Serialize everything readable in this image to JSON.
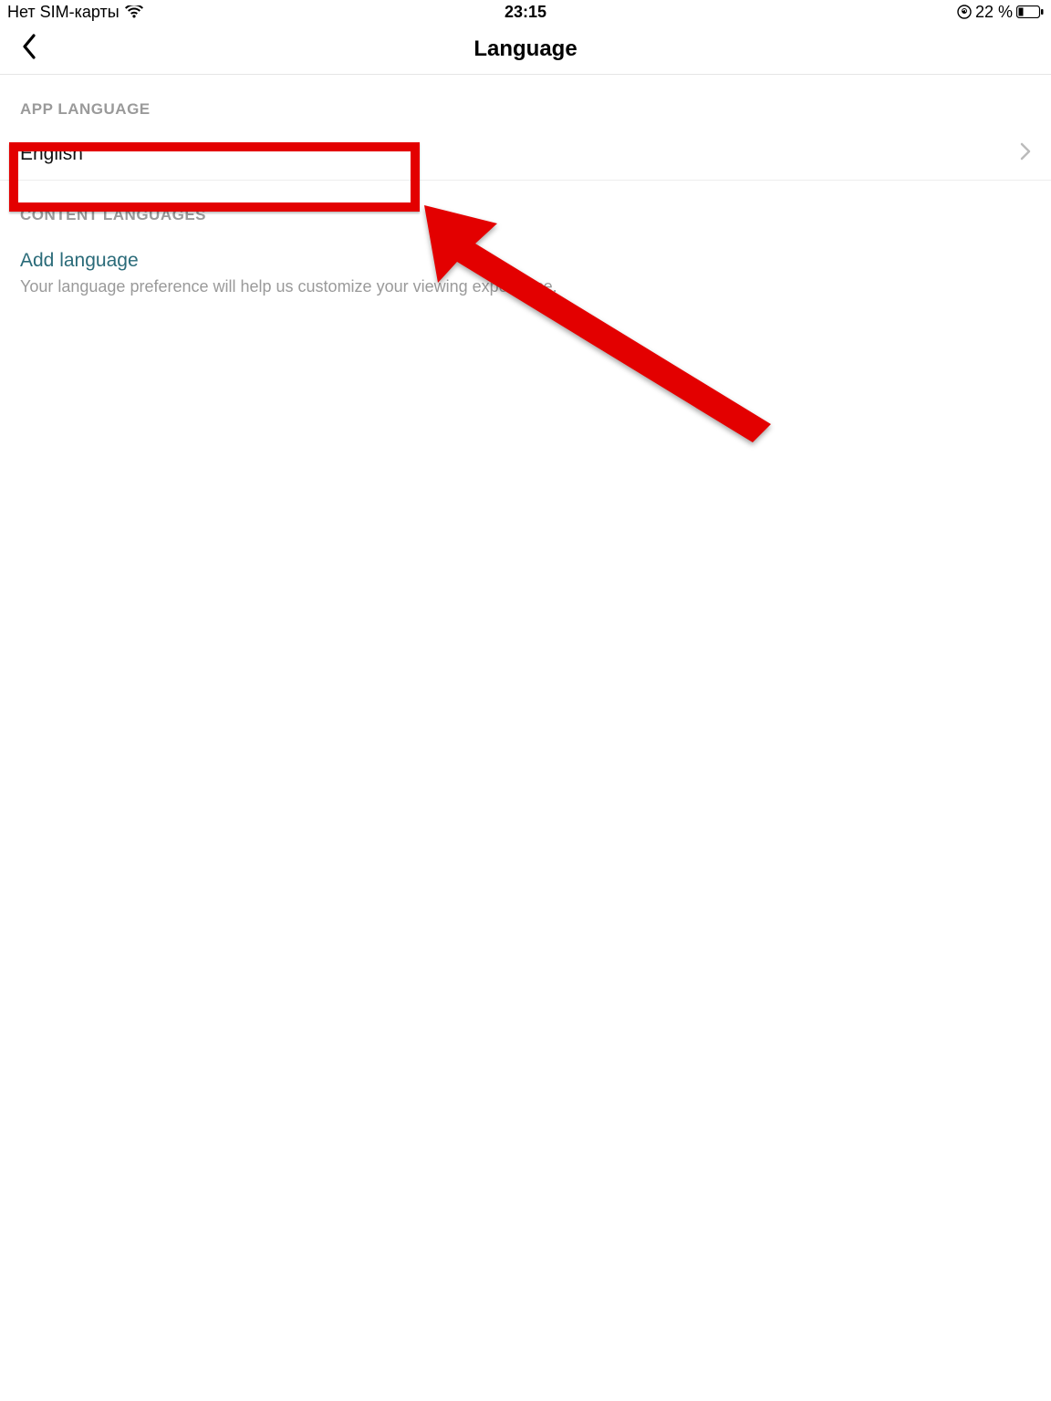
{
  "status_bar": {
    "sim_text": "Нет SIM-карты",
    "time": "23:15",
    "battery_text": "22 %"
  },
  "nav": {
    "title": "Language"
  },
  "sections": {
    "app_language": {
      "header": "APP LANGUAGE",
      "selected": "English"
    },
    "content_languages": {
      "header": "CONTENT LANGUAGES",
      "add_label": "Add language",
      "hint": "Your language preference will help us customize your viewing experience."
    }
  }
}
